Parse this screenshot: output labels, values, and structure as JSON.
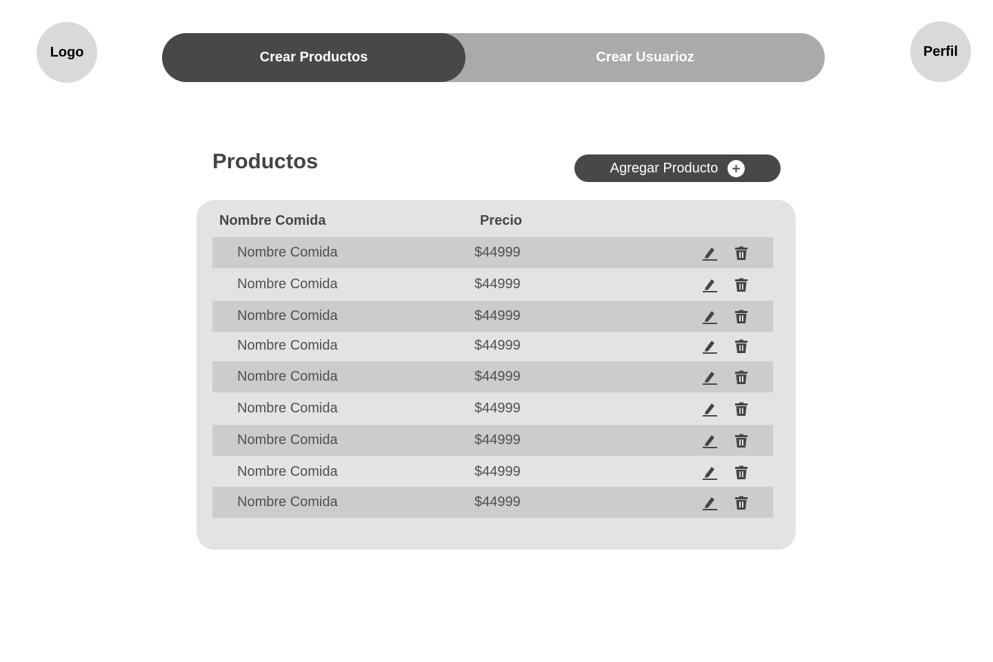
{
  "header": {
    "logo_label": "Logo",
    "profile_label": "Perfil",
    "tabs": [
      {
        "label": "Crear Productos",
        "active": true
      },
      {
        "label": "Crear Usuarioz",
        "active": false
      }
    ]
  },
  "main": {
    "title": "Productos",
    "add_button_label": "Agregar Producto",
    "table": {
      "columns": [
        "Nombre Comida",
        "Precio"
      ],
      "rows": [
        {
          "name": "Nombre Comida",
          "price": "$44999"
        },
        {
          "name": "Nombre Comida",
          "price": "$44999"
        },
        {
          "name": "Nombre Comida",
          "price": "$44999"
        },
        {
          "name": "Nombre Comida",
          "price": "$44999"
        },
        {
          "name": "Nombre Comida",
          "price": "$44999"
        },
        {
          "name": "Nombre Comida",
          "price": "$44999"
        },
        {
          "name": "Nombre Comida",
          "price": "$44999"
        },
        {
          "name": "Nombre Comida",
          "price": "$44999"
        },
        {
          "name": "Nombre Comida",
          "price": "$44999"
        }
      ],
      "row_actions": [
        "pencil-icon",
        "trash-icon"
      ]
    }
  },
  "colors": {
    "dark": "#484848",
    "tab_inactive": "#aaaaaa",
    "card": "#e3e3e3",
    "row_shaded": "#cccccc",
    "circle": "#d9d9d9"
  }
}
